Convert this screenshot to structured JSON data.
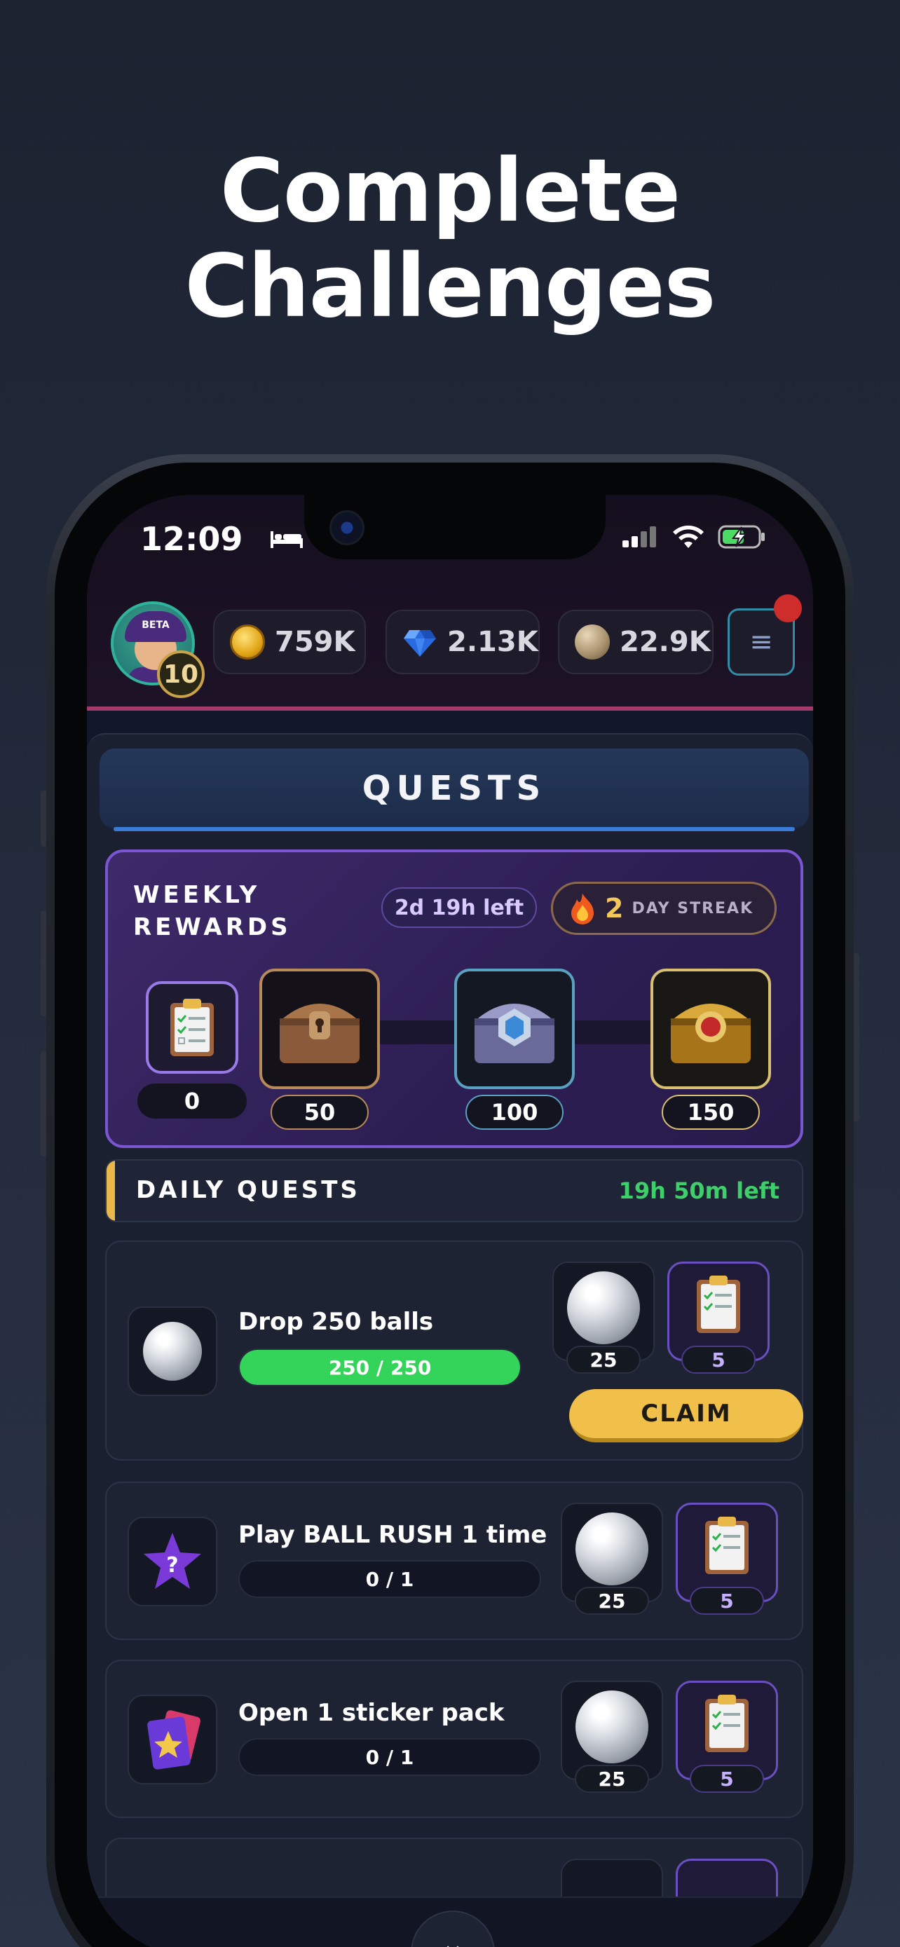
{
  "headline": {
    "line1": "Complete",
    "line2": "Challenges"
  },
  "status_bar": {
    "time": "12:09"
  },
  "profile": {
    "level": "10",
    "avatar_cap_text": "BETA"
  },
  "currencies": {
    "coins": "759K",
    "gems": "2.13K",
    "balls": "22.9K"
  },
  "quests_title": "QUESTS",
  "weekly": {
    "title_line1": "WEEKLY",
    "title_line2": "REWARDS",
    "time_left": "2d 19h left",
    "streak_count": "2",
    "streak_label": "DAY STREAK",
    "current_points": "0",
    "milestones": [
      "50",
      "100",
      "150"
    ]
  },
  "daily": {
    "title": "DAILY QUESTS",
    "time_left": "19h 50m left"
  },
  "quests": [
    {
      "name": "Drop 250 balls",
      "progress_text": "250 / 250",
      "progress": 1.0,
      "reward_balls": "25",
      "reward_points": "5",
      "claim_label": "CLAIM"
    },
    {
      "name": "Play BALL RUSH 1 time",
      "progress_text": "0 / 1",
      "progress": 0.0,
      "reward_balls": "25",
      "reward_points": "5",
      "icon_glyph": "?"
    },
    {
      "name": "Open 1 sticker pack",
      "progress_text": "0 / 1",
      "progress": 0.0,
      "reward_balls": "25",
      "reward_points": "5"
    }
  ],
  "colors": {
    "accent_blue": "#3b7bd8",
    "weekly_border": "#7a56d0",
    "progress_green": "#34d45a",
    "claim_yellow": "#f0c04a",
    "timer_green": "#3ecf6a"
  }
}
